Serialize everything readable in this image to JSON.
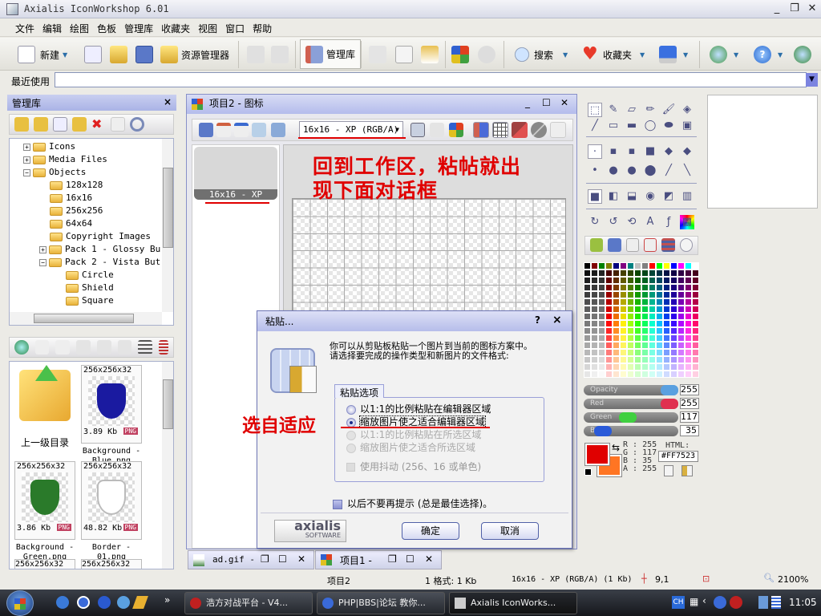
{
  "app": {
    "title": "Axialis IconWorkshop 6.01"
  },
  "menu": [
    "文件",
    "编辑",
    "绘图",
    "色板",
    "管理库",
    "收藏夹",
    "视图",
    "窗口",
    "帮助"
  ],
  "toolbar": {
    "new": "新建",
    "explorer": "资源管理器",
    "library": "管理库",
    "search": "搜索",
    "favorites": "收藏夹"
  },
  "recent": {
    "label": "最近使用",
    "value": ""
  },
  "library_panel": {
    "title": "管理库",
    "close": "×",
    "tree": [
      {
        "label": "Icons",
        "level": 0,
        "expander": "+"
      },
      {
        "label": "Media Files",
        "level": 0,
        "expander": "+"
      },
      {
        "label": "Objects",
        "level": 0,
        "expander": "-"
      },
      {
        "label": "128x128",
        "level": 1
      },
      {
        "label": "16x16",
        "level": 1
      },
      {
        "label": "256x256",
        "level": 1
      },
      {
        "label": "64x64",
        "level": 1
      },
      {
        "label": "Copyright Images",
        "level": 1
      },
      {
        "label": "Pack 1 - Glossy Bu",
        "level": 1,
        "expander": "+"
      },
      {
        "label": "Pack 2 - Vista But",
        "level": 1,
        "expander": "-"
      },
      {
        "label": "Circle",
        "level": 2
      },
      {
        "label": "Shield",
        "level": 2
      },
      {
        "label": "Square",
        "level": 2
      }
    ]
  },
  "thumbs": {
    "parent": "上一级目录",
    "items": [
      {
        "dims": "256x256x32",
        "size": "3.89 Kb",
        "fmt": "PNG",
        "name": "Background - Blue.png",
        "color": "#1a1aa0"
      },
      {
        "dims": "256x256x32",
        "size": "3.86 Kb",
        "fmt": "PNG",
        "name": "Background - Green.png",
        "color": "#2a7a2a"
      },
      {
        "dims": "256x256x32",
        "size": "48.82 Kb",
        "fmt": "PNG",
        "name": "Border - 01.png",
        "color": "#ffffff"
      }
    ],
    "more": [
      "256x256x32",
      "256x256x32"
    ]
  },
  "doc": {
    "title": "项目2 - 图标",
    "format": "16x16 - XP (RGB/A)",
    "thumb_label": "16x16 - XP"
  },
  "annotations": {
    "top_line1": "回到工作区，粘帖就出",
    "top_line2": "现下面对话框",
    "side": "选自适应"
  },
  "dialog": {
    "title": "粘贴...",
    "help": "?",
    "close": "×",
    "desc1": "你可以从剪贴板粘贴一个图片到当前的图标方案中。",
    "desc2": "请选择要完成的操作类型和新图片的文件格式:",
    "group": "粘贴选项",
    "options": [
      {
        "label": "以1:1的比例粘贴在编辑器区域",
        "checked": false,
        "enabled": true
      },
      {
        "label": "缩放图片使之适合编辑器区域",
        "checked": true,
        "enabled": true
      },
      {
        "label": "以1:1的比例粘贴在所选区域",
        "checked": false,
        "enabled": false
      },
      {
        "label": "缩放图片使之适合所选区域",
        "checked": false,
        "enabled": false
      }
    ],
    "dither": "使用抖动 (256、16 或单色)",
    "dont_ask": "以后不要再提示 (总是最佳选择)。",
    "logo1": "axialis",
    "logo2": "SOFTWARE",
    "ok": "确定",
    "cancel": "取消"
  },
  "doc_tabs": [
    "ad.gif -",
    "项目1 -"
  ],
  "color": {
    "opacity_label": "Opacity",
    "red_label": "Red",
    "green_label": "Green",
    "blue_label": "B",
    "opacity": "255",
    "red": "255",
    "green": "117",
    "blue": "35",
    "opacity_pct": 100,
    "red_pct": 100,
    "green_pct": 46,
    "blue_pct": 14,
    "r_line": "R : 255",
    "g_line": "G : 117",
    "b_line": "B :  35",
    "a_line": "A : 255",
    "html_label": "HTML:",
    "html": "#FF7523",
    "primary": "#e00000",
    "secondary": "#ff7523",
    "palette_row1": [
      "#000000",
      "#800000",
      "#008000",
      "#808000",
      "#000080",
      "#800080",
      "#008080",
      "#c0c0c0",
      "#808080",
      "#ff0000",
      "#00ff00",
      "#ffff00",
      "#0000ff",
      "#ff00ff",
      "#00ffff",
      "#ffffff"
    ]
  },
  "status": {
    "project": "项目2",
    "formats": "1 格式: 1 Kb",
    "format": "16x16 - XP (RGB/A) (1 Kb)",
    "coords": "9,1",
    "zoom": "2100%"
  },
  "taskbar": {
    "tasks": [
      "浩方对战平台 - V4...",
      "PHP|BBS|论坛 教你...",
      "Axialis IconWorks..."
    ],
    "lang": "CH",
    "time": "11:05"
  }
}
